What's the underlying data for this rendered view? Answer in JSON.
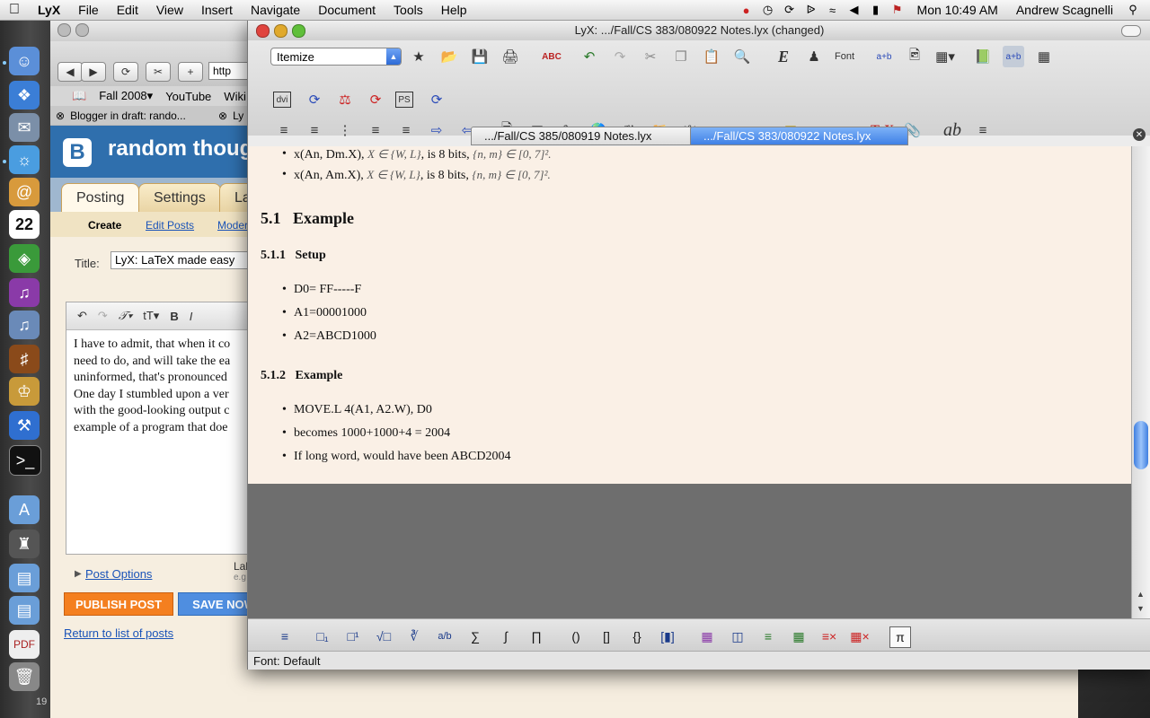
{
  "menubar": {
    "app": "LyX",
    "items": [
      "File",
      "Edit",
      "View",
      "Insert",
      "Navigate",
      "Document",
      "Tools",
      "Help"
    ],
    "clock": "Mon 10:49 AM",
    "user": "Andrew Scagnelli"
  },
  "dock": {
    "calendar_day": "22",
    "badge": "19"
  },
  "browser": {
    "bookmarks": [
      "Fall 2008▾",
      "YouTube",
      "Wiki"
    ],
    "url_fragment": "http",
    "tabs": [
      "Blogger in draft: rando...",
      "Ly"
    ],
    "blog_title": "random though",
    "blog_tabs": [
      "Posting",
      "Settings",
      "La"
    ],
    "subnav": [
      "Create",
      "Edit Posts",
      "Moder"
    ],
    "title_label": "Title:",
    "title_value": "LyX: LaTeX made easy",
    "editor_lines": [
      "I have to admit, that when it co",
      "need to do, and will take the ea",
      "uninformed, that's pronounced",
      "One day I stumbled upon a ver",
      "with the good-looking output c",
      "example of a program that doe"
    ],
    "post_options": "Post Options",
    "labels_hint": "Lal",
    "labels_hint2": "e.g",
    "publish": "PUBLISH POST",
    "save_now": "SAVE NOW",
    "return_link": "Return to list of posts"
  },
  "lyx": {
    "window_title": "LyX: .../Fall/CS 383/080922 Notes.lyx (changed)",
    "layout_value": "Itemize",
    "tabs": [
      ".../Fall/CS 385/080919 Notes.lyx",
      ".../Fall/CS 383/080922 Notes.lyx"
    ],
    "active_tab": 1,
    "doc": {
      "bullets_top": [
        {
          "pre": "x(An, Dm.X), ",
          "math": "X ∈ {W, L}",
          "mid": ", is 8 bits, ",
          "math2": "{n, m} ∈ [0, 7]²."
        },
        {
          "pre": "x(An, Am.X), ",
          "math": "X ∈ {W, L}",
          "mid": ", is 8 bits, ",
          "math2": "{n, m} ∈ [0, 7]²."
        }
      ],
      "section": "5.1   Example",
      "subsection1": "5.1.1   Setup",
      "setup_items": [
        "D0= FF-----F",
        "A1=00001000",
        "A2=ABCD1000"
      ],
      "subsection2": "5.1.2   Example",
      "example_items": [
        "MOVE.L 4(A1, A2.W), D0",
        "becomes 1000+1000+4 = 2004",
        "If long word, would have been ABCD2004"
      ]
    },
    "status": "Font: Default",
    "toolbar_labels": {
      "font": "Font",
      "tex": "TeX",
      "ab": "ab",
      "dvi": "dvi",
      "ps": "PS"
    }
  }
}
